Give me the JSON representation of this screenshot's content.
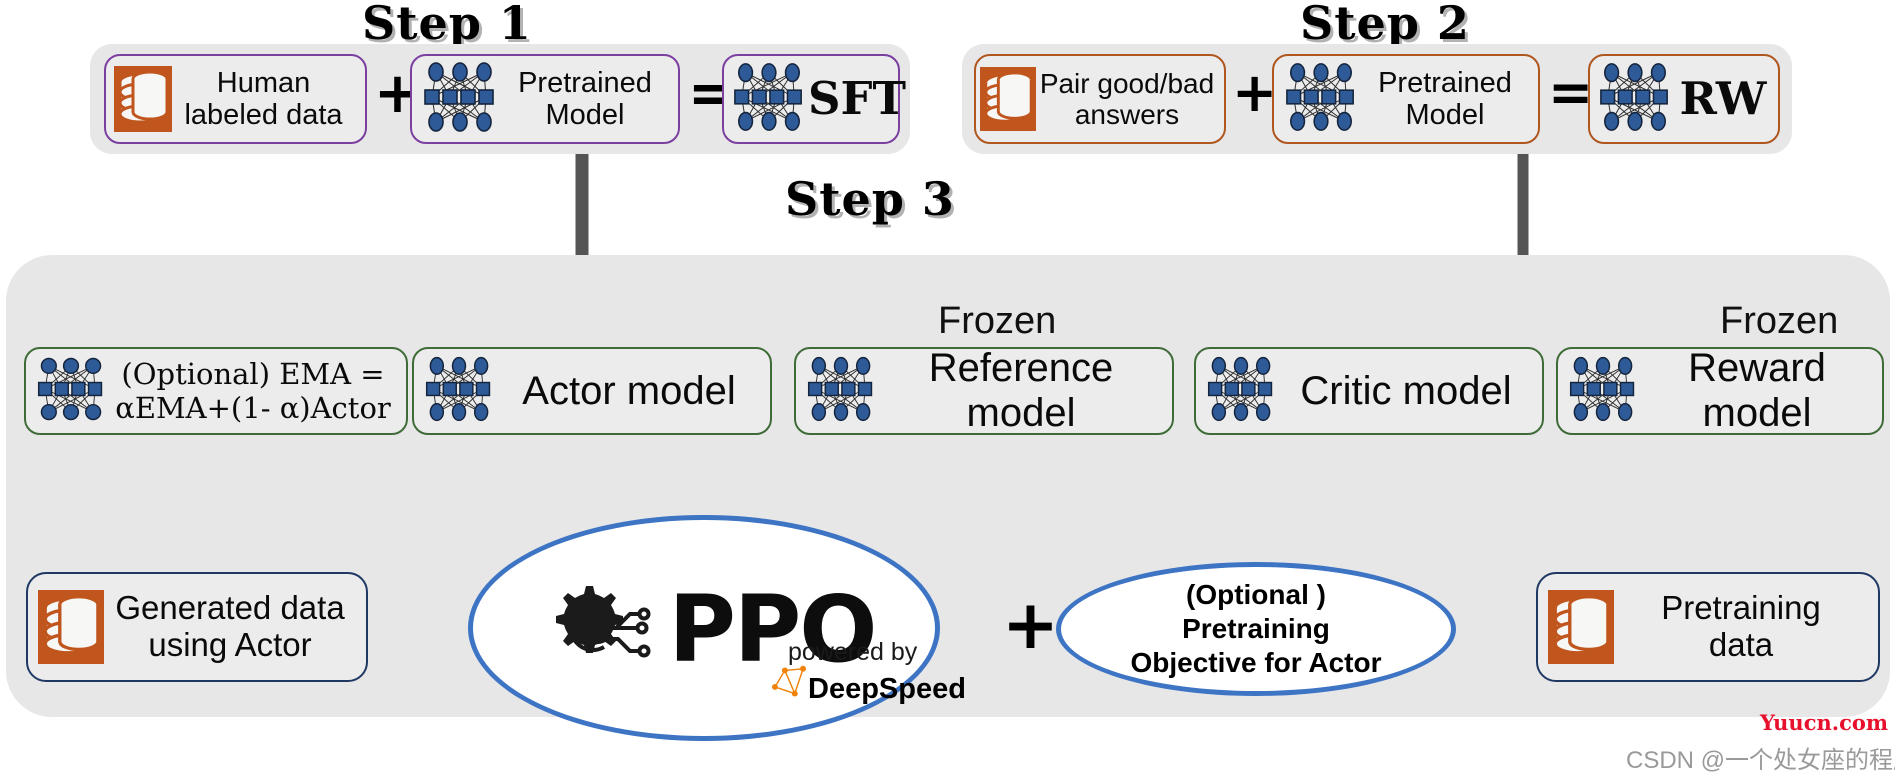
{
  "steps": {
    "step1": {
      "title": "Step 1",
      "cards": [
        {
          "label": "Human\nlabeled data",
          "icon": "database-icon"
        },
        {
          "label": "Pretrained\nModel",
          "icon": "neural-net-icon"
        },
        {
          "label": "SFT",
          "icon": "neural-net-icon"
        }
      ],
      "operators": [
        "+",
        "="
      ],
      "border_color": "#7b3fa0"
    },
    "step2": {
      "title": "Step 2",
      "cards": [
        {
          "label": "Pair good/bad\nanswers",
          "icon": "database-icon"
        },
        {
          "label": "Pretrained\nModel",
          "icon": "neural-net-icon"
        },
        {
          "label": "RW",
          "icon": "neural-net-icon"
        }
      ],
      "operators": [
        "+",
        "="
      ],
      "border_color": "#b0561f"
    },
    "step3": {
      "title": "Step 3",
      "models": [
        {
          "label": "(Optional) EMA =\nαEMA+(1- α)Actor",
          "icon": "neural-net-icon",
          "frozen": false
        },
        {
          "label": "Actor model",
          "icon": "neural-net-icon",
          "frozen": false
        },
        {
          "label": "Reference\nmodel",
          "icon": "neural-net-icon",
          "frozen": true
        },
        {
          "label": "Critic model",
          "icon": "neural-net-icon",
          "frozen": false
        },
        {
          "label": "Reward\nmodel",
          "icon": "neural-net-icon",
          "frozen": true
        }
      ],
      "frozen_label": "Frozen",
      "border_color": "#3f6b38"
    }
  },
  "bottom": {
    "generated_data": {
      "label": "Generated data\nusing Actor",
      "icon": "database-icon"
    },
    "pretraining_data": {
      "label": "Pretraining\ndata",
      "icon": "database-icon"
    },
    "ppo": {
      "name": "PPO",
      "powered_by": "powered by",
      "engine": "DeepSpeed",
      "logo": "gear-circuit-icon",
      "ds_logo": "deepspeed-graph-icon"
    },
    "plus_operator": "+",
    "optional_objective": "(Optional )\nPretraining\nObjective for Actor"
  },
  "watermarks": {
    "site": "Yuucn.com",
    "csdn": "CSDN @一个处女座的程序猿"
  },
  "colors": {
    "panel_bg": "#e7e7e7",
    "purple": "#7b3fa0",
    "brown": "#b0561f",
    "green": "#3f6b38",
    "navy": "#1f3864",
    "blue_arrow": "#3d74c4",
    "pale_blue_arrow": "#7f9fd4",
    "gray_arrow": "#666666",
    "db_orange": "#c0561d",
    "watermark_red": "#e8112d"
  }
}
